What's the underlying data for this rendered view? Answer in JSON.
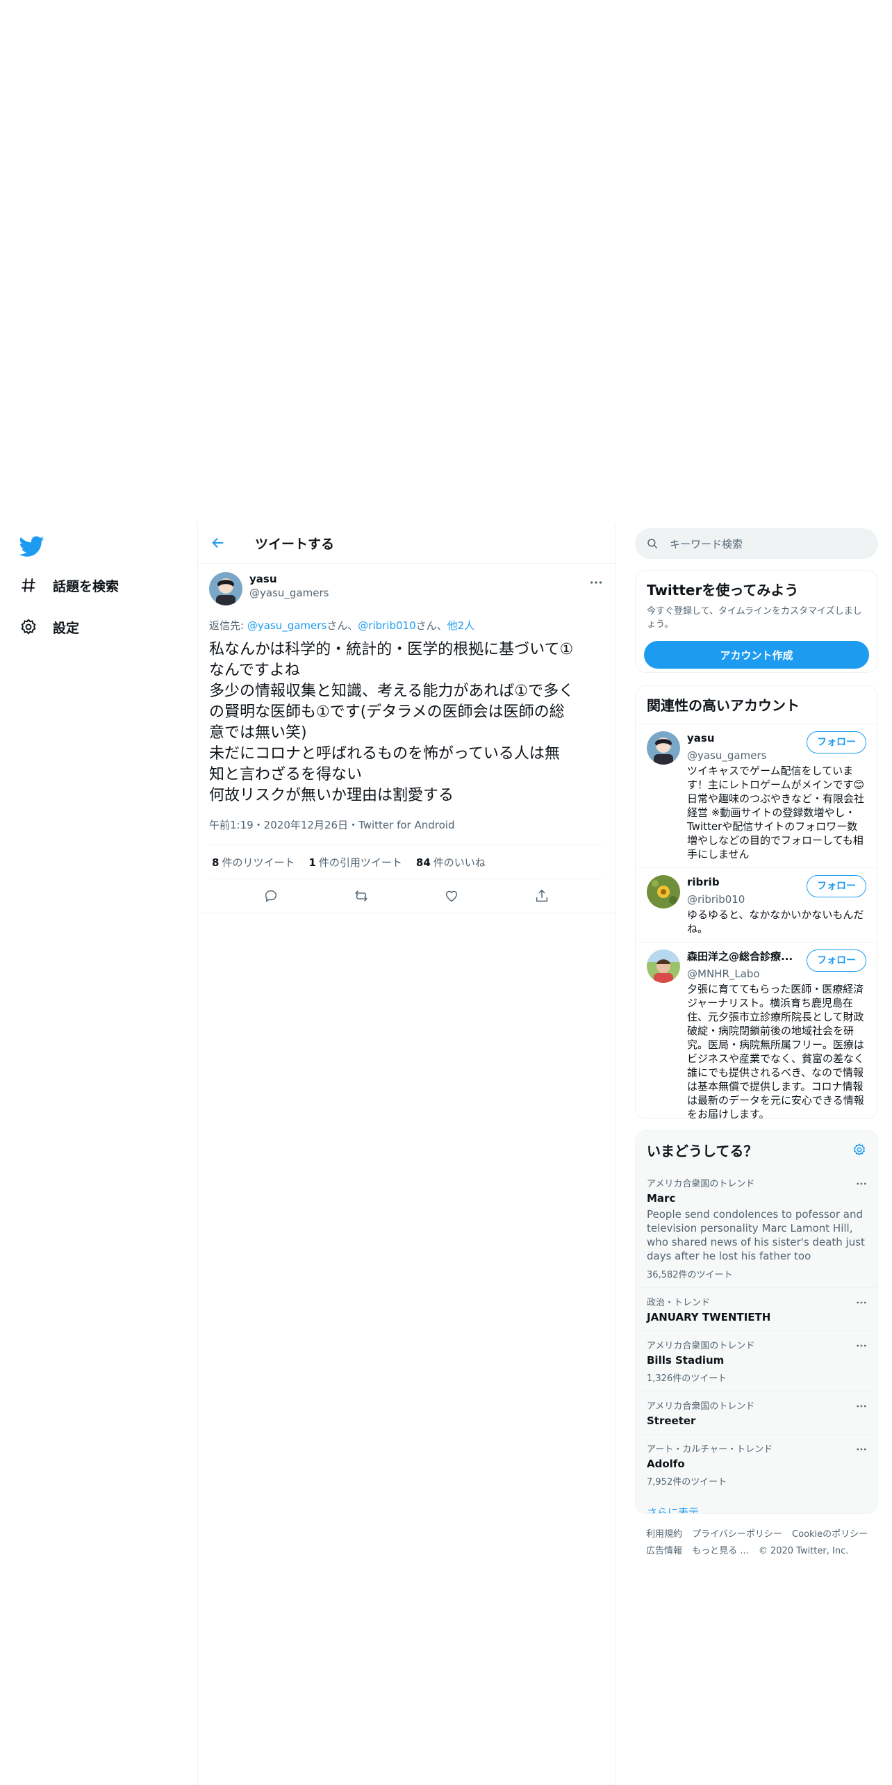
{
  "nav": {
    "items": [
      {
        "label": "話題を検索",
        "icon": "hashtag-icon"
      },
      {
        "label": "設定",
        "icon": "gear-icon"
      }
    ]
  },
  "header": {
    "title": "ツイートする"
  },
  "tweet": {
    "author_name": "yasu",
    "author_handle": "@yasu_gamers",
    "reply_prefix": "返信先: ",
    "reply_user1": "@yasu_gamers",
    "reply_sep1": "さん、",
    "reply_user2": "@ribrib010",
    "reply_sep2": "さん、",
    "reply_others": "他2人",
    "lines": [
      "私なんかは科学的・統計的・医学的根拠に基づいて①",
      "なんですよね",
      "多少の情報収集と知識、考える能力があれば①で多く",
      "の賢明な医師も①です(デタラメの医師会は医師の総",
      "意では無い笑)",
      "未だにコロナと呼ばれるものを怖がっている人は無",
      "知と言わざるを得ない",
      "何故リスクが無いか理由は割愛する"
    ],
    "meta": "午前1:19・2020年12月26日・Twitter for Android",
    "retweets": "8",
    "retweets_label": "件のリツイート",
    "quotes": "1",
    "quotes_label": "件の引用ツイート",
    "likes": "84",
    "likes_label": "件のいいね"
  },
  "search": {
    "placeholder": "キーワード検索"
  },
  "signup": {
    "title": "Twitterを使ってみよう",
    "text": "今すぐ登録して、タイムラインをカスタマイズしましょう。",
    "button": "アカウント作成"
  },
  "related": {
    "title": "関連性の高いアカウント",
    "follow_label": "フォロー",
    "users": [
      {
        "name": "yasu",
        "handle": "@yasu_gamers",
        "bio": "ツイキャスでゲーム配信をしています！主にレトロゲームがメインです😊 日常や趣味のつぶやきなど・有限会社経営 ※動画サイトの登録数増やし・Twitterや配信サイトのフォロワー数増やしなどの目的でフォローしても相手にしません"
      },
      {
        "name": "ribrib",
        "handle": "@ribrib010",
        "bio": "ゆるゆると、なかなかいかないもんだね。"
      },
      {
        "name": "森田洋之@総合診療...",
        "handle": "@MNHR_Labo",
        "bio": "夕張に育ててもらった医師・医療経済ジャーナリスト。横浜育ち鹿児島在住、元夕張市立診療所院長として財政破綻・病院閉鎖前後の地域社会を研究。医局・病院無所属フリー。医療はビジネスや産業でなく、貧富の差なく誰にでも提供されるべき、なので情報は基本無償で提供します。コロナ情報は最新のデータを元に安心できる情報をお届けします。"
      }
    ]
  },
  "trends": {
    "title": "いまどうしてる？",
    "items": [
      {
        "context": "アメリカ合衆国のトレンド",
        "name": "Marc",
        "desc": "People send condolences to pofessor and television personality Marc Lamont Hill, who shared news of his sister's death just days after he lost his father too",
        "count": "36,582件のツイート"
      },
      {
        "context": "政治・トレンド",
        "name": "JANUARY TWENTIETH",
        "desc": "",
        "count": ""
      },
      {
        "context": "アメリカ合衆国のトレンド",
        "name": "Bills Stadium",
        "desc": "",
        "count": "1,326件のツイート"
      },
      {
        "context": "アメリカ合衆国のトレンド",
        "name": "Streeter",
        "desc": "",
        "count": ""
      },
      {
        "context": "アート・カルチャー・トレンド",
        "name": "Adolfo",
        "desc": "",
        "count": "7,952件のツイート"
      }
    ],
    "show_more": "さらに表示"
  },
  "footer": {
    "links": [
      "利用規約",
      "プライバシーポリシー",
      "Cookieのポリシー",
      "広告情報",
      "もっと見る ..."
    ],
    "copyright": "© 2020 Twitter, Inc."
  },
  "colors": {
    "accent": "#1d9bf0",
    "text": "#0f1419",
    "muted": "#536471"
  }
}
